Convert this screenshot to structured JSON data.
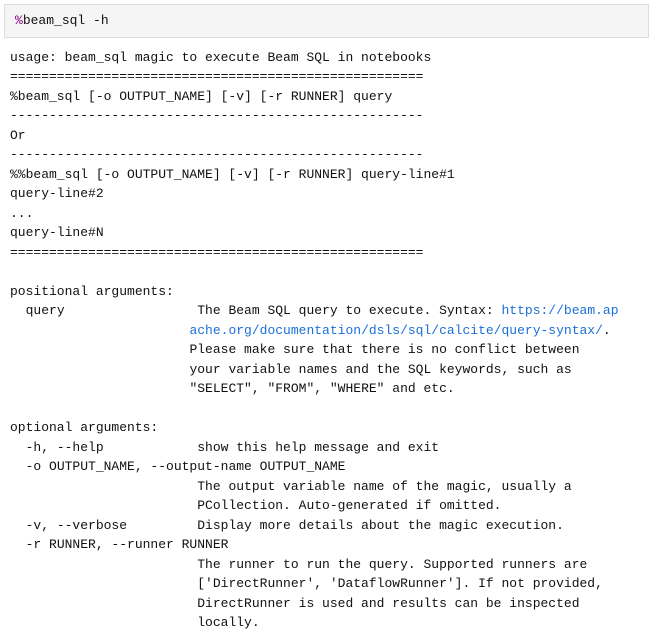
{
  "input": {
    "magic_prefix": "%",
    "command": "beam_sql -h"
  },
  "output": {
    "usage_line": "usage: beam_sql magic to execute Beam SQL in notebooks",
    "sep_a": "=====================================================",
    "usage1": "%beam_sql [-o OUTPUT_NAME] [-v] [-r RUNNER] query",
    "dash1": "-----------------------------------------------------",
    "or": "Or",
    "dash2": "-----------------------------------------------------",
    "usage2a": "%%beam_sql [-o OUTPUT_NAME] [-v] [-r RUNNER] query-line#1",
    "usage2b": "query-line#2",
    "usage2c": "...",
    "usage2d": "query-line#N",
    "sep_b": "=====================================================",
    "pos_header": "positional arguments:",
    "pos_query_label": "  query",
    "pos_query_desc_pre": "                 The Beam SQL query to execute. Syntax: ",
    "pos_query_link_text": "https://beam.ap",
    "pos_query_link_cont": "                       ache.org/documentation/dsls/sql/calcite/query-syntax/",
    "pos_query_desc2": "                       Please make sure that there is no conflict between",
    "pos_query_desc3": "                       your variable names and the SQL keywords, such as",
    "pos_query_desc4": "                       \"SELECT\", \"FROM\", \"WHERE\" and etc.",
    "opt_header": "optional arguments:",
    "opt_help": "  -h, --help            show this help message and exit",
    "opt_o": "  -o OUTPUT_NAME, --output-name OUTPUT_NAME",
    "opt_o_desc1": "                        The output variable name of the magic, usually a",
    "opt_o_desc2": "                        PCollection. Auto-generated if omitted.",
    "opt_v": "  -v, --verbose         Display more details about the magic execution.",
    "opt_r": "  -r RUNNER, --runner RUNNER",
    "opt_r_desc1": "                        The runner to run the query. Supported runners are",
    "opt_r_desc2": "                        ['DirectRunner', 'DataflowRunner']. If not provided,",
    "opt_r_desc3": "                        DirectRunner is used and results can be inspected",
    "opt_r_desc4": "                        locally.",
    "link_href": "https://beam.apache.org/documentation/dsls/sql/calcite/query-syntax/"
  }
}
